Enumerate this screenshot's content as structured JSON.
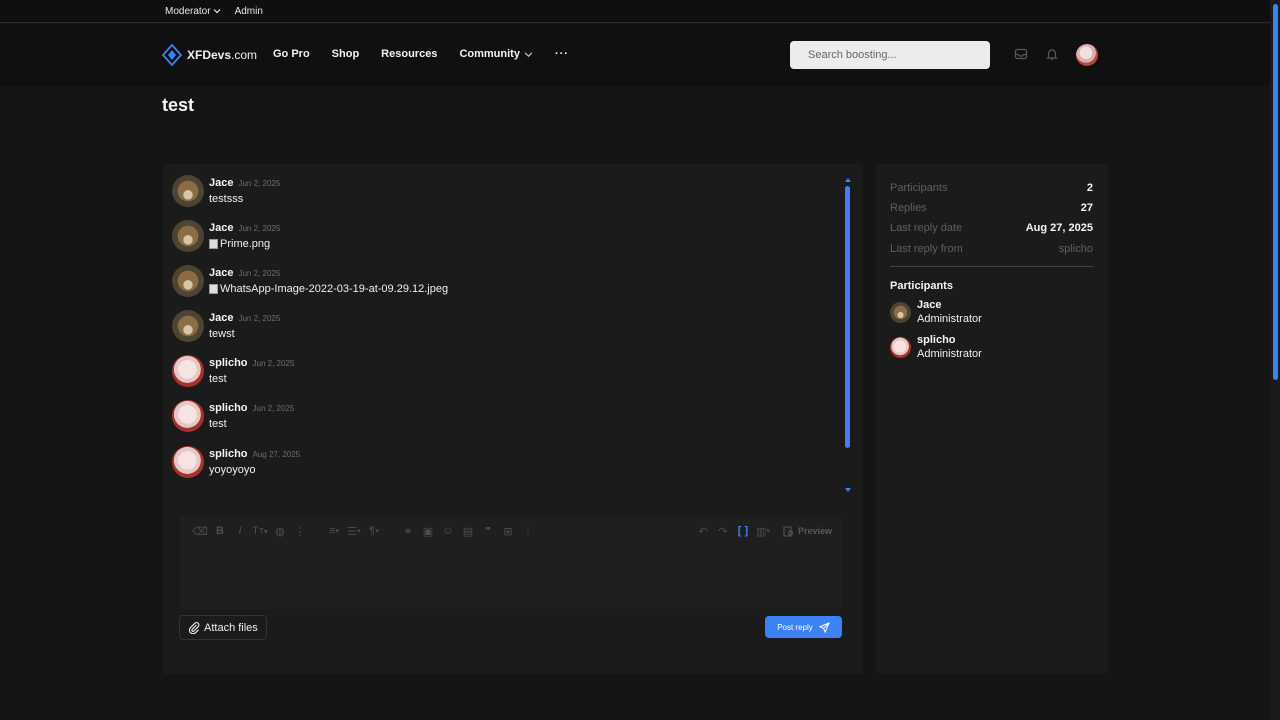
{
  "staff_bar": {
    "moderator": "Moderator",
    "admin": "Admin"
  },
  "header": {
    "logo_bold": "XFDevs",
    "logo_light": ".com",
    "nav": [
      "Go Pro",
      "Shop",
      "Resources",
      "Community"
    ],
    "more": "···",
    "search_placeholder": "Search boosting..."
  },
  "page": {
    "title": "test"
  },
  "messages": [
    {
      "user": "Jace",
      "date": "Jun 2, 2025",
      "text": "testsss",
      "avatar": "jace"
    },
    {
      "user": "Jace",
      "date": "Jun 2, 2025",
      "text": "Prime.png",
      "image": true,
      "avatar": "jace"
    },
    {
      "user": "Jace",
      "date": "Jun 2, 2025",
      "text": "WhatsApp-Image-2022-03-19-at-09.29.12.jpeg",
      "image": true,
      "avatar": "jace"
    },
    {
      "user": "Jace",
      "date": "Jun 2, 2025",
      "text": "tewst",
      "avatar": "jace"
    },
    {
      "user": "splicho",
      "date": "Jun 2, 2025",
      "text": "test",
      "avatar": "splicho"
    },
    {
      "user": "splicho",
      "date": "Jun 2, 2025",
      "text": "test",
      "avatar": "splicho"
    },
    {
      "user": "splicho",
      "date": "Aug 27, 2025",
      "text": "yoyoyoyo",
      "avatar": "splicho"
    }
  ],
  "editor": {
    "preview_label": "Preview"
  },
  "actions": {
    "attach_label": "Attach files",
    "post_label": "Post reply"
  },
  "sidebar": {
    "stats": {
      "participants_label": "Participants",
      "participants_value": "2",
      "replies_label": "Replies",
      "replies_value": "27",
      "last_reply_date_label": "Last reply date",
      "last_reply_date_value": "Aug 27, 2025",
      "last_reply_from_label": "Last reply from",
      "last_reply_from_value": "splicho"
    },
    "participants_heading": "Participants",
    "participants": [
      {
        "name": "Jace",
        "role": "Administrator"
      },
      {
        "name": "splicho",
        "role": "Administrator"
      }
    ]
  },
  "colors": {
    "accent": "#3b82f6",
    "background": "#151515",
    "panel": "#1b1b1b"
  }
}
